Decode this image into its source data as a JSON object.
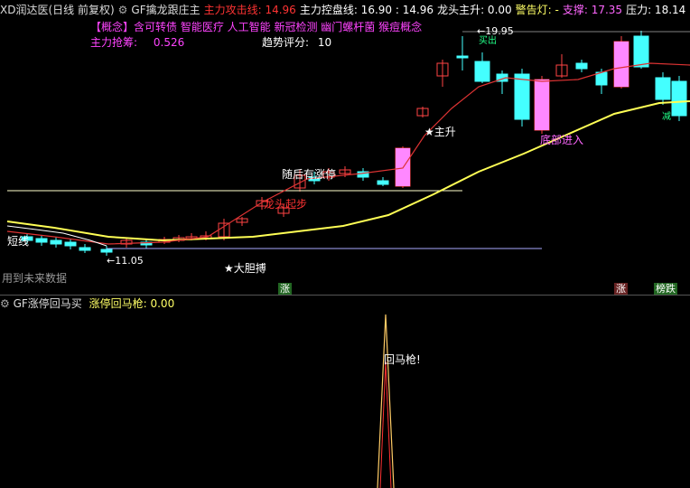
{
  "header": {
    "title": "XD润达医(日线 前复权)",
    "indicator_name": "GF擒龙跟庄主",
    "items": [
      {
        "label": "主力攻击线: 14.96",
        "color": "#ff3333"
      },
      {
        "label": "主力控盘线: 16.90 : 14.96",
        "color": "#ffffff"
      },
      {
        "label": "龙头主升: 0.00",
        "color": "#ffffff"
      },
      {
        "label": "警告灯: -",
        "color": "#ffff66"
      },
      {
        "label": "支撑: 17.35",
        "color": "#ff66ff"
      },
      {
        "label": "压力: 18.14",
        "color": "#ffffff"
      }
    ]
  },
  "concept": {
    "text": "【概念】含可转债 智能医疗 人工智能 新冠检测 幽门螺杆菌 猴痘概念",
    "color": "#ff44ff"
  },
  "stats": {
    "main_force_label": "主力抢筹:",
    "main_force_value": "0.526",
    "trend_label": "趋势评分:",
    "trend_value": "10"
  },
  "annotations": {
    "price_high": "19.95",
    "price_low": "11.05",
    "short_label": "短线",
    "star_main_rise": "★主升",
    "star_bold_bet": "★大胆搏",
    "next_limit_up": "随后有涨停",
    "signal_text": "龙头起步",
    "breakout": "底部进入",
    "future_data": "用到未来数据",
    "buy_mark_1": "买出",
    "buy_mark_2": "减"
  },
  "bottom_tags": {
    "left": "涨",
    "right1": "涨",
    "right2": "榜跌"
  },
  "sub_panel": {
    "indicator_name": "GF涨停回马买",
    "value_label": "涨停回马枪: 0.00",
    "signal_label": "回马枪!"
  },
  "colors": {
    "up": "#ff44ff",
    "down": "#44ffff",
    "ma_yellow": "#ffff55",
    "ma_red": "#dd3333",
    "line_white": "#ffffff"
  }
}
